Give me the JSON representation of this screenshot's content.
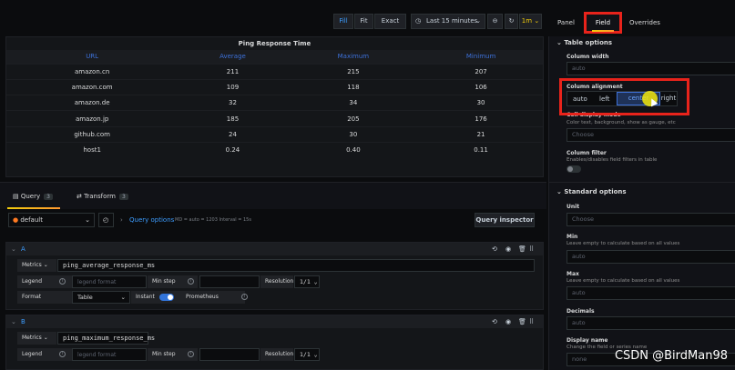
{
  "toolbar": {
    "fill": "Fill",
    "fit": "Fit",
    "exact": "Exact",
    "time_range": "Last 15 minutes",
    "refresh": "1m"
  },
  "right_tabs": {
    "panel": "Panel",
    "field": "Field",
    "overrides": "Overrides"
  },
  "panel": {
    "title": "Ping Response Time",
    "columns": [
      "URL",
      "Average",
      "Maximum",
      "Minimum"
    ],
    "rows": [
      [
        "amazon.cn",
        "211",
        "215",
        "207"
      ],
      [
        "amazon.com",
        "109",
        "118",
        "106"
      ],
      [
        "amazon.de",
        "32",
        "34",
        "30"
      ],
      [
        "amazon.jp",
        "185",
        "205",
        "176"
      ],
      [
        "github.com",
        "24",
        "30",
        "21"
      ],
      [
        "host1",
        "0.24",
        "0.40",
        "0.11"
      ]
    ]
  },
  "query_tabs": {
    "query": "Query",
    "query_count": "3",
    "transform": "Transform",
    "transform_count": "3"
  },
  "query_bar": {
    "datasource": "default",
    "query_options": "Query options",
    "options_detail": "MD = auto = 1203   Interval = 15s",
    "inspector": "Query inspector"
  },
  "query_a": {
    "letter": "A",
    "metrics_label": "Metrics",
    "metrics_value": "ping_average_response_ms",
    "legend_label": "Legend",
    "legend_placeholder": "legend format",
    "minstep_label": "Min step",
    "resolution_label": "Resolution",
    "resolution_value": "1/1",
    "format_label": "Format",
    "format_value": "Table",
    "instant_label": "Instant",
    "prometheus_label": "Prometheus"
  },
  "query_b": {
    "letter": "B",
    "metrics_label": "Metrics",
    "metrics_value": "ping_maximum_response_ms",
    "legend_label": "Legend",
    "legend_placeholder": "legend format",
    "minstep_label": "Min step",
    "resolution_label": "Resolution",
    "resolution_value": "1/1"
  },
  "options": {
    "table_options": "Table options",
    "column_width": "Column width",
    "column_width_placeholder": "auto",
    "column_alignment": "Column alignment",
    "align_auto": "auto",
    "align_left": "left",
    "align_center": "center",
    "align_right": "right",
    "cell_display": "Cell display mode",
    "cell_display_desc": "Color text, background, show as gauge, etc",
    "cell_display_placeholder": "Choose",
    "column_filter": "Column filter",
    "column_filter_desc": "Enables/disables field filters in table",
    "standard_options": "Standard options",
    "unit": "Unit",
    "unit_placeholder": "Choose",
    "min": "Min",
    "min_desc": "Leave empty to calculate based on all values",
    "min_placeholder": "auto",
    "max": "Max",
    "max_desc": "Leave empty to calculate based on all values",
    "max_placeholder": "auto",
    "decimals": "Decimals",
    "decimals_placeholder": "auto",
    "display_name": "Display name",
    "display_name_desc": "Change the field or series name",
    "display_name_placeholder": "none"
  },
  "watermark": "CSDN @BirdMan98",
  "colors": {
    "accent": "#3d9dff",
    "highlight": "#e8231b",
    "cursor": "#f2e70c"
  }
}
